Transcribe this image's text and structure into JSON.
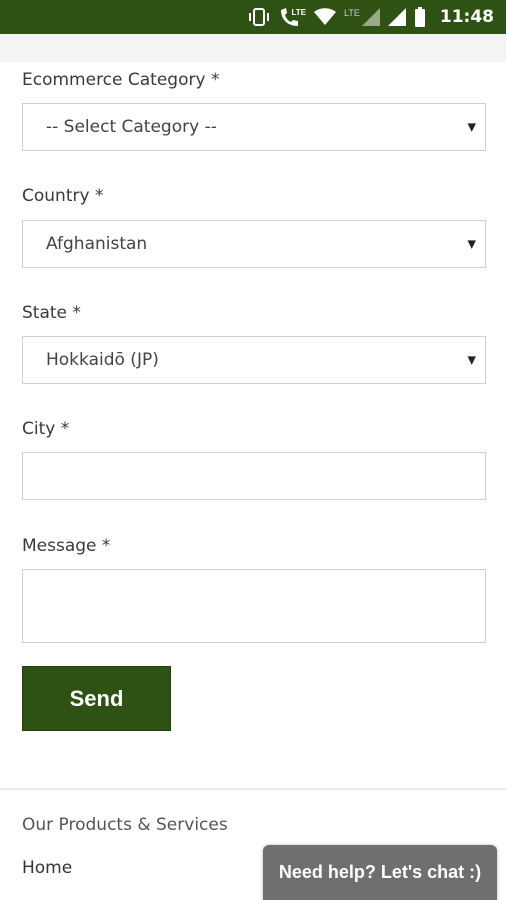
{
  "status_bar": {
    "network_label": "LTE",
    "network_label_2": "LTE",
    "time": "11:48"
  },
  "form": {
    "category": {
      "label": "Ecommerce Category *",
      "value": "-- Select Category --"
    },
    "country": {
      "label": "Country *",
      "value": "Afghanistan"
    },
    "state": {
      "label": "State *",
      "value": "Hokkaidō (JP)"
    },
    "city": {
      "label": "City *",
      "value": ""
    },
    "message": {
      "label": "Message *",
      "value": ""
    },
    "send_label": "Send"
  },
  "footer": {
    "heading": "Our Products & Services",
    "link_home": "Home"
  },
  "chat": {
    "label": "Need help? Let's chat :)"
  },
  "colors": {
    "brand": "#2e5213",
    "chat_bg": "#6f6f6f"
  },
  "icons": [
    "vibrate-icon",
    "call-lte-icon",
    "wifi-icon",
    "signal-icon",
    "signal-full-icon",
    "battery-icon",
    "dropdown-caret-icon"
  ]
}
